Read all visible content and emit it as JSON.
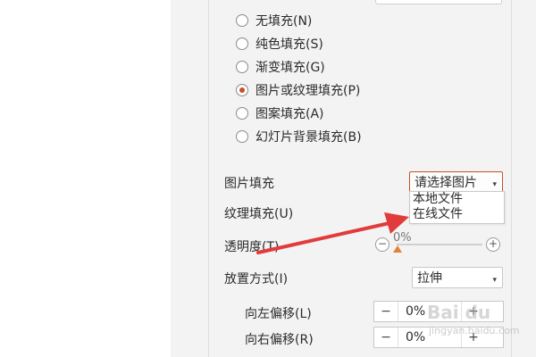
{
  "fill_options": [
    {
      "label": "无填充(N)",
      "checked": false
    },
    {
      "label": "纯色填充(S)",
      "checked": false
    },
    {
      "label": "渐变填充(G)",
      "checked": false
    },
    {
      "label": "图片或纹理填充(P)",
      "checked": true
    },
    {
      "label": "图案填充(A)",
      "checked": false
    },
    {
      "label": "幻灯片背景填充(B)",
      "checked": false
    }
  ],
  "picture_fill": {
    "label": "图片填充",
    "select_value": "请选择图片",
    "options": [
      "本地文件",
      "在线文件"
    ]
  },
  "texture_fill": {
    "label": "纹理填充(U)"
  },
  "transparency": {
    "label": "透明度(T)",
    "value": "0%",
    "level_percent": 0
  },
  "placement": {
    "label": "放置方式(I)",
    "value": "拉伸"
  },
  "offset_left": {
    "label": "向左偏移(L)",
    "value": "0%"
  },
  "offset_right": {
    "label": "向右偏移(R)",
    "value": "0%"
  },
  "watermark": {
    "main": "Bai du",
    "sub": "jingyan.baidu.com"
  },
  "colors": {
    "accent": "#c8511f",
    "arrow": "#e23b3b",
    "thumb": "#e0833a"
  }
}
